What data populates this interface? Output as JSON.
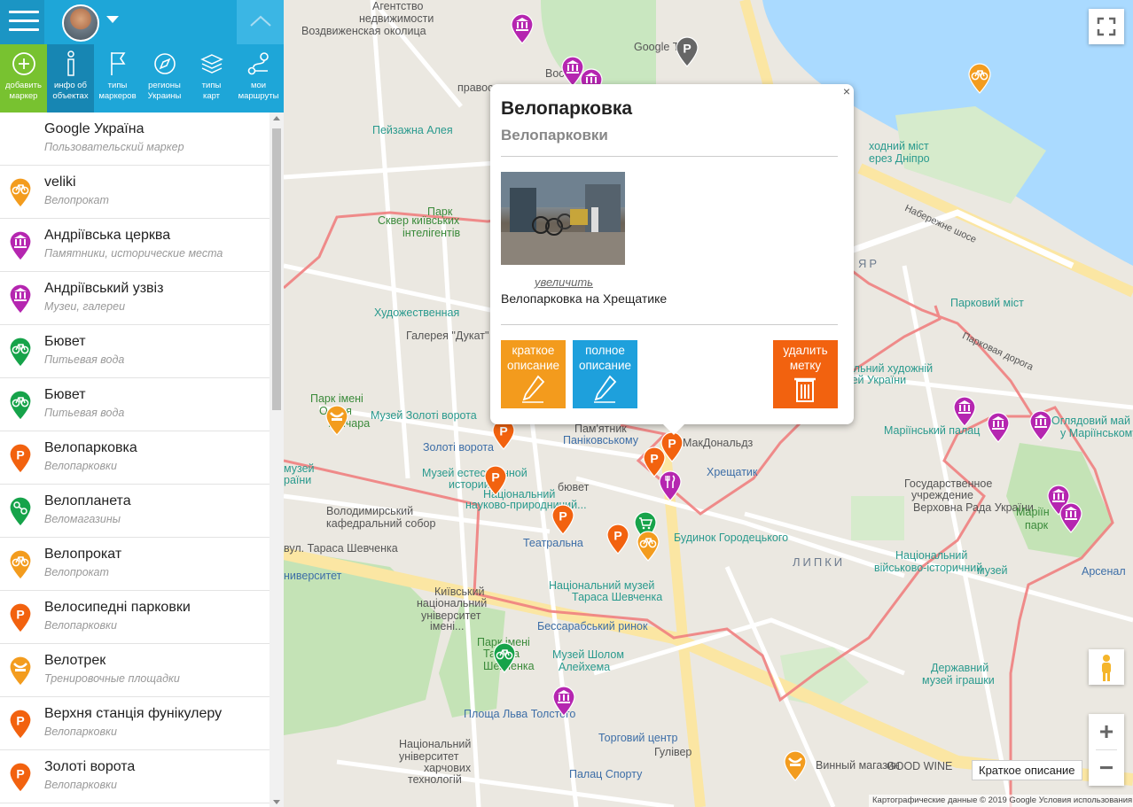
{
  "toolbar": {
    "tools": [
      {
        "label": "добавить\nмаркер",
        "icon": "plus-circle-icon"
      },
      {
        "label": "инфо об\nобъектах",
        "icon": "info-icon"
      },
      {
        "label": "типы\nмаркеров",
        "icon": "flag-icon"
      },
      {
        "label": "регионы\nУкраины",
        "icon": "compass-icon"
      },
      {
        "label": "типы\nкарт",
        "icon": "layers-icon"
      },
      {
        "label": "мои\nмаршруты",
        "icon": "route-icon"
      }
    ]
  },
  "marker_list": [
    {
      "title": "Google Україна",
      "subtitle": "Пользовательский маркер",
      "icon": "none",
      "color": ""
    },
    {
      "title": "veliki",
      "subtitle": "Велопрокат",
      "icon": "bicycle-icon",
      "color": "#f39c1e"
    },
    {
      "title": "Андріївська церква",
      "subtitle": "Памятники, исторические места",
      "icon": "museum-icon",
      "color": "#b526b0"
    },
    {
      "title": "Андріївський узвіз",
      "subtitle": "Музеи, галереи",
      "icon": "museum-icon",
      "color": "#b526b0"
    },
    {
      "title": "Бювет",
      "subtitle": "Питьевая вода",
      "icon": "bicycle-icon",
      "color": "#16a34a"
    },
    {
      "title": "Бювет",
      "subtitle": "Питьевая вода",
      "icon": "bicycle-icon",
      "color": "#16a34a"
    },
    {
      "title": "Велопарковка",
      "subtitle": "Велопарковки",
      "icon": "parking-icon",
      "color": "#f2620f"
    },
    {
      "title": "Велопланета",
      "subtitle": "Веломагазины",
      "icon": "tools-icon",
      "color": "#16a34a"
    },
    {
      "title": "Велопрокат",
      "subtitle": "Велопрокат",
      "icon": "bicycle-icon",
      "color": "#f39c1e"
    },
    {
      "title": "Велосипедні парковки",
      "subtitle": "Велопарковки",
      "icon": "parking-icon",
      "color": "#f2620f"
    },
    {
      "title": "Велотрек",
      "subtitle": "Тренировочные площадки",
      "icon": "track-icon",
      "color": "#f39c1e"
    },
    {
      "title": "Верхня станція фунікулеру",
      "subtitle": "Велопарковки",
      "icon": "parking-icon",
      "color": "#f2620f"
    },
    {
      "title": "Золоті ворота",
      "subtitle": "Велопарковки",
      "icon": "parking-icon",
      "color": "#f2620f"
    }
  ],
  "popup": {
    "title": "Велопарковка",
    "category": "Велопарковки",
    "zoom_link": "увеличить",
    "description": "Велопарковка на Хрещатике",
    "close": "×",
    "buttons": {
      "short": "краткое\nописание",
      "full": "полное\nописание",
      "delete": "удалить\nметку"
    }
  },
  "map": {
    "hint": "Краткое описание",
    "attribution": "Картографические данные © 2019 Google     Условия использования",
    "labels": [
      {
        "text": "Агентство",
        "cls": "gray"
      },
      {
        "text": "недвижимости",
        "cls": "gray"
      },
      {
        "text": "Воздвиженская околица",
        "cls": "gray"
      },
      {
        "text": "Google Тік",
        "cls": "gray"
      },
      {
        "text": "Восточн",
        "cls": "gray"
      },
      {
        "text": "Пейзажна Алея",
        "cls": "poi"
      },
      {
        "text": "Парк",
        "cls": "green"
      },
      {
        "text": "Сквер київських",
        "cls": "green"
      },
      {
        "text": "інтелігентів",
        "cls": "green"
      },
      {
        "text": "Художественная",
        "cls": "poi"
      },
      {
        "text": "Галерея \"Дукат\"",
        "cls": "gray"
      },
      {
        "text": "Парк імені",
        "cls": "green"
      },
      {
        "text": "Олеся",
        "cls": "green"
      },
      {
        "text": "Гончара",
        "cls": "green"
      },
      {
        "text": "Музей Золоті ворота",
        "cls": "poi"
      },
      {
        "text": "Золоті ворота",
        "cls": "blue"
      },
      {
        "text": "Музей естественной",
        "cls": "poi"
      },
      {
        "text": "истории",
        "cls": "poi"
      },
      {
        "text": "Національний",
        "cls": "poi"
      },
      {
        "text": "науково-природничий...",
        "cls": "poi"
      },
      {
        "text": "Володимирський",
        "cls": "gray"
      },
      {
        "text": "кафедральний собор",
        "cls": "gray"
      },
      {
        "text": "Театральна",
        "cls": "blue"
      },
      {
        "text": "Пам'ятник",
        "cls": "gray"
      },
      {
        "text": "Паніковському",
        "cls": "blue"
      },
      {
        "text": "МакДональдз",
        "cls": "gray"
      },
      {
        "text": "Хрещатик",
        "cls": "blue"
      },
      {
        "text": "Будинок Городецького",
        "cls": "poi"
      },
      {
        "text": "ЛИПКИ",
        "cls": "dist"
      },
      {
        "text": "Національний музей",
        "cls": "poi"
      },
      {
        "text": "Тараса Шевченка",
        "cls": "poi"
      },
      {
        "text": "Бессарабський ринок",
        "cls": "blue"
      },
      {
        "text": "Київський",
        "cls": "gray"
      },
      {
        "text": "національний",
        "cls": "gray"
      },
      {
        "text": "університет",
        "cls": "gray"
      },
      {
        "text": "імені...",
        "cls": "gray"
      },
      {
        "text": "Парк імені",
        "cls": "green"
      },
      {
        "text": "Тараса",
        "cls": "green"
      },
      {
        "text": "Шевченка",
        "cls": "green"
      },
      {
        "text": "Музей Шолом",
        "cls": "poi"
      },
      {
        "text": "Алейхема",
        "cls": "poi"
      },
      {
        "text": "Площа Льва Толстого",
        "cls": "blue"
      },
      {
        "text": "Торговий центр",
        "cls": "blue"
      },
      {
        "text": "Гулівер",
        "cls": "gray"
      },
      {
        "text": "Національний",
        "cls": "gray"
      },
      {
        "text": "університет",
        "cls": "gray"
      },
      {
        "text": "харчових",
        "cls": "gray"
      },
      {
        "text": "технологій",
        "cls": "gray"
      },
      {
        "text": "Палац Спорту",
        "cls": "blue"
      },
      {
        "text": "Винный магазин",
        "cls": "gray"
      },
      {
        "text": "GOOD WINE",
        "cls": "gray"
      },
      {
        "text": "Державний",
        "cls": "poi"
      },
      {
        "text": "музей іграшки",
        "cls": "poi"
      },
      {
        "text": "Національний",
        "cls": "poi"
      },
      {
        "text": "військово-історичний",
        "cls": "poi"
      },
      {
        "text": "музей",
        "cls": "poi"
      },
      {
        "text": "Государственное",
        "cls": "gray"
      },
      {
        "text": "учреждение",
        "cls": "gray"
      },
      {
        "text": "Верховна Рада України",
        "cls": "gray"
      },
      {
        "text": "Маріїнський палац",
        "cls": "poi"
      },
      {
        "text": "Маріїн",
        "cls": "green"
      },
      {
        "text": "парк",
        "cls": "green"
      },
      {
        "text": "Оглядовий май",
        "cls": "poi"
      },
      {
        "text": "у Маріїнському",
        "cls": "poi"
      },
      {
        "text": "Арсенал",
        "cls": "blue"
      },
      {
        "text": "ональний художній",
        "cls": "poi"
      },
      {
        "text": "музей України",
        "cls": "poi"
      },
      {
        "text": "Парковий міст",
        "cls": "poi"
      },
      {
        "text": "ЯР",
        "cls": "dist"
      },
      {
        "text": "ходний міст",
        "cls": "poi"
      },
      {
        "text": "ерез Дніпро",
        "cls": "poi"
      },
      {
        "text": "Набережне шосе",
        "cls": "gray"
      },
      {
        "text": "Парковая дорога",
        "cls": "gray"
      },
      {
        "text": "правосл",
        "cls": "gray"
      },
      {
        "text": "вул. Тараса Шевченка",
        "cls": "gray"
      },
      {
        "text": "бювет",
        "cls": "gray"
      },
      {
        "text": "музей",
        "cls": "poi"
      },
      {
        "text": "раїни",
        "cls": "poi"
      },
      {
        "text": "ниверситет",
        "cls": "blue"
      }
    ],
    "markers": [
      {
        "type": "museum",
        "color": "#b526b0"
      },
      {
        "type": "museum",
        "color": "#b526b0"
      },
      {
        "type": "museum",
        "color": "#b526b0"
      },
      {
        "type": "parking-gray",
        "color": "#666666"
      },
      {
        "type": "bicycle",
        "color": "#f39c1e"
      },
      {
        "type": "parking",
        "color": "#f2620f"
      },
      {
        "type": "parking",
        "color": "#f2620f"
      },
      {
        "type": "parking",
        "color": "#f2620f"
      },
      {
        "type": "parking",
        "color": "#f2620f"
      },
      {
        "type": "parking",
        "color": "#f2620f"
      },
      {
        "type": "parking",
        "color": "#f2620f"
      },
      {
        "type": "restaurant",
        "color": "#b526b0"
      },
      {
        "type": "shop",
        "color": "#16a34a"
      },
      {
        "type": "bicycle",
        "color": "#f39c1e"
      },
      {
        "type": "bicycle",
        "color": "#16a34a"
      },
      {
        "type": "museum",
        "color": "#b526b0"
      },
      {
        "type": "track",
        "color": "#f39c1e"
      },
      {
        "type": "track",
        "color": "#f39c1e"
      },
      {
        "type": "museum",
        "color": "#b526b0"
      },
      {
        "type": "museum",
        "color": "#b526b0"
      },
      {
        "type": "museum",
        "color": "#b526b0"
      },
      {
        "type": "museum",
        "color": "#b526b0"
      },
      {
        "type": "museum",
        "color": "#b526b0"
      }
    ]
  }
}
